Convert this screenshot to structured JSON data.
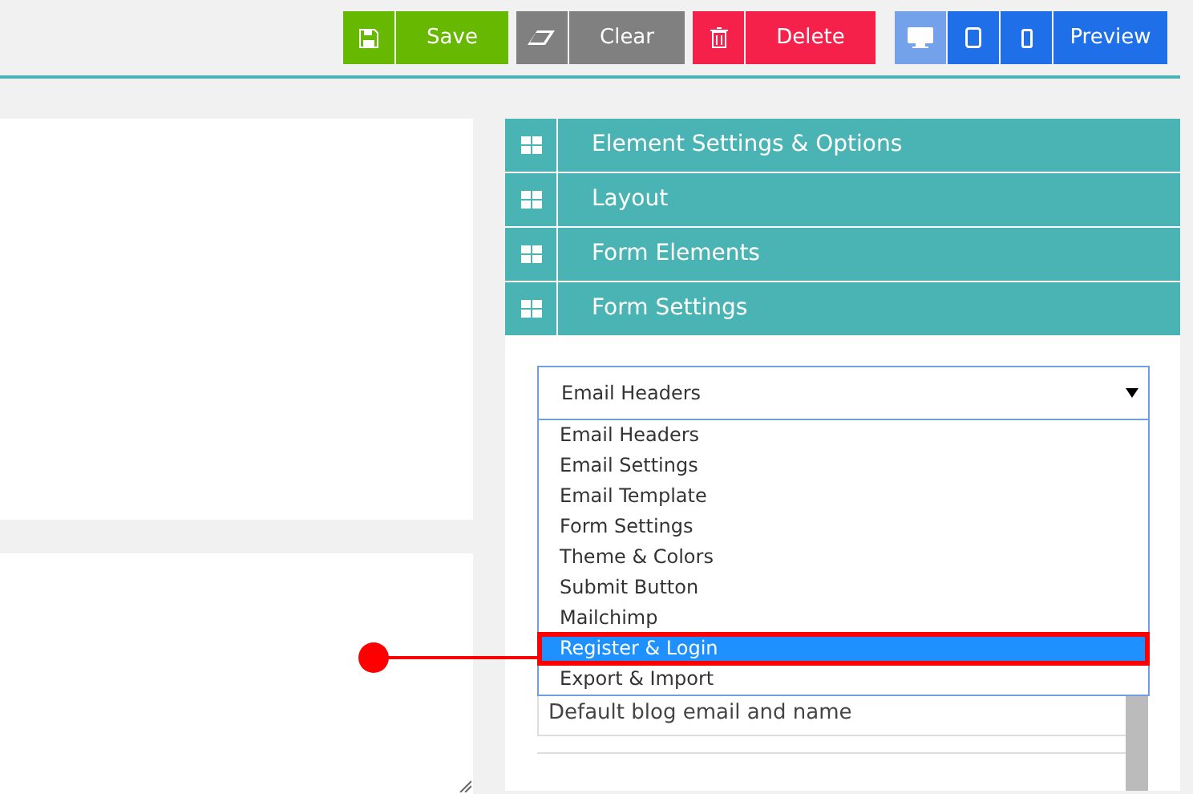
{
  "toolbar": {
    "actions": [
      {
        "kind": "save",
        "label": "Save"
      },
      {
        "kind": "clear",
        "label": "Clear"
      },
      {
        "kind": "delete",
        "label": "Delete"
      }
    ],
    "devices": [
      {
        "kind": "desktop",
        "selected": true
      },
      {
        "kind": "tablet",
        "selected": false
      },
      {
        "kind": "mobile",
        "selected": false
      }
    ],
    "preview": "Preview"
  },
  "sections": [
    {
      "title": "Element Settings & Options"
    },
    {
      "title": "Layout"
    },
    {
      "title": "Form Elements"
    },
    {
      "title": "Form Settings",
      "panel": {
        "settings_select": {
          "value": "Email Headers",
          "expanded": true,
          "options": [
            {
              "label": "Email Headers",
              "highlighted": false
            },
            {
              "label": "Email Settings",
              "highlighted": false
            },
            {
              "label": "Email Template",
              "highlighted": false
            },
            {
              "label": "Form Settings",
              "highlighted": false
            },
            {
              "label": "Theme & Colors",
              "highlighted": false
            },
            {
              "label": "Submit Button",
              "highlighted": false
            },
            {
              "label": "Mailchimp",
              "highlighted": false
            },
            {
              "label": "Register & Login",
              "highlighted": true
            },
            {
              "label": "Export & Import",
              "highlighted": false
            }
          ]
        },
        "sender_select": {
          "value": "Default blog email and name"
        }
      }
    }
  ]
}
